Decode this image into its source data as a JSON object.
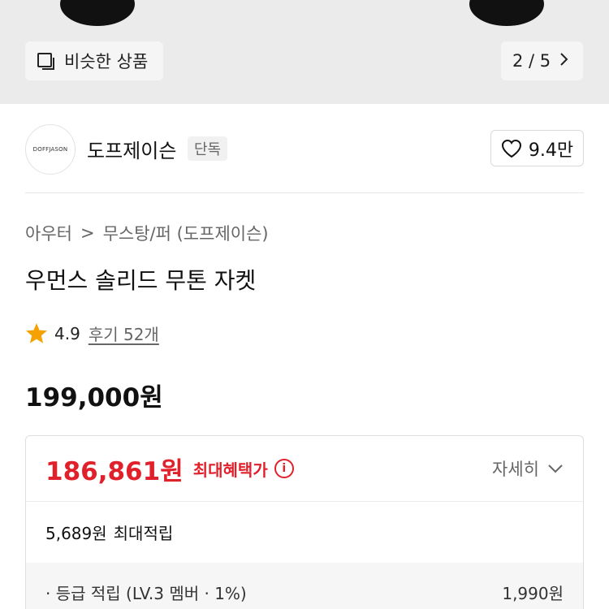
{
  "hero": {
    "similar_label": "비슷한 상품",
    "similar_icon": "similar-products-icon",
    "pager_text": "2 / 5",
    "pager_icon": "chevron-right-icon"
  },
  "brand": {
    "logo_text": "DOFFJASON",
    "name": "도프제이슨",
    "badge": "단독",
    "likes": "9.4만",
    "like_icon": "heart-icon"
  },
  "breadcrumb": {
    "category": "아우터",
    "separator": ">",
    "subcategory": "무스탕/퍼 (도프제이슨)"
  },
  "product": {
    "title": "우먼스 솔리드 무톤 자켓",
    "rating": "4.9",
    "reviews": "후기 52개",
    "price": "199,000원"
  },
  "benefit": {
    "best_price": "186,861원",
    "best_label": "최대혜택가",
    "info_icon": "i",
    "detail_label": "자세히",
    "points_amount": "5,689원",
    "points_label": "최대적립",
    "grade_label": "· 등급 적립 (LV.3 멤버 · 1%)",
    "grade_amount": "1,990원"
  },
  "colors": {
    "accent_red": "#e0212b",
    "star": "#f5a200"
  }
}
